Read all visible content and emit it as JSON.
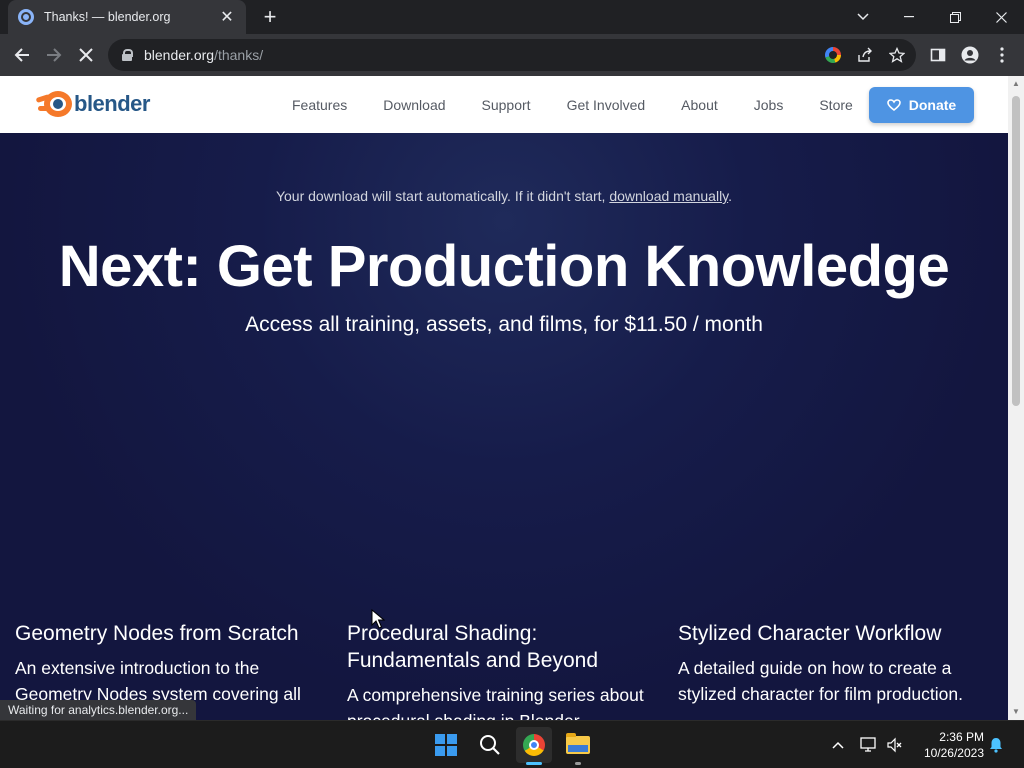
{
  "browser": {
    "tab_title": "Thanks! — blender.org",
    "tab_close": "✕",
    "new_tab": "+",
    "url_host": "blender.org",
    "url_path": "/thanks/",
    "status_text": "Waiting for analytics.blender.org..."
  },
  "site": {
    "logo_text": "blender",
    "nav": [
      "Features",
      "Download",
      "Support",
      "Get Involved",
      "About",
      "Jobs",
      "Store"
    ],
    "donate_label": "Donate"
  },
  "hero": {
    "notice_prefix": "Your download will start automatically. If it didn't start, ",
    "notice_link": "download manually",
    "notice_suffix": ".",
    "headline": "Next: Get Production Knowledge",
    "subhead": "Access all training, assets, and films, for $11.50 / month"
  },
  "cards": [
    {
      "title": "Geometry Nodes from Scratch",
      "desc": "An extensive introduction to the Geometry Nodes system covering all"
    },
    {
      "title": "Procedural Shading: Fundamentals and Beyond",
      "desc": "A comprehensive training series about procedural shading in Blender."
    },
    {
      "title": "Stylized Character Workflow",
      "desc": "A detailed guide on how to create a stylized character for film production."
    }
  ],
  "taskbar": {
    "time": "2:36 PM",
    "date": "10/26/2023"
  },
  "colors": {
    "hero_bg": "#13163f",
    "donate_bg": "#4e94e3",
    "blender_orange": "#f5792a",
    "blender_blue": "#265787"
  }
}
